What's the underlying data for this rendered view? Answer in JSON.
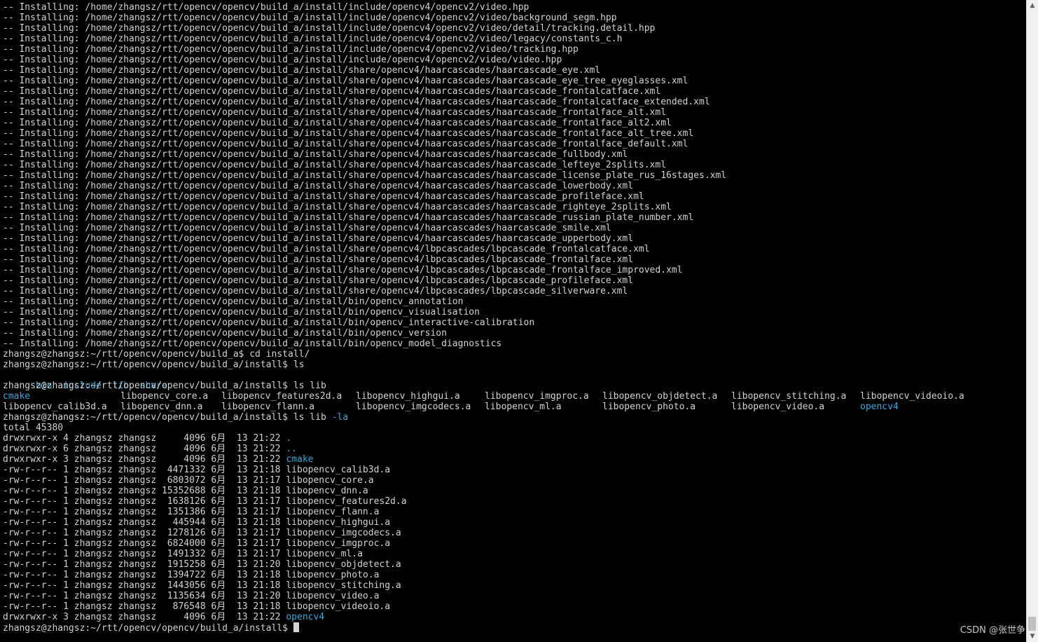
{
  "install_lines": [
    "-- Installing: /home/zhangsz/rtt/opencv/opencv/build_a/install/include/opencv4/opencv2/video.hpp",
    "-- Installing: /home/zhangsz/rtt/opencv/opencv/build_a/install/include/opencv4/opencv2/video/background_segm.hpp",
    "-- Installing: /home/zhangsz/rtt/opencv/opencv/build_a/install/include/opencv4/opencv2/video/detail/tracking.detail.hpp",
    "-- Installing: /home/zhangsz/rtt/opencv/opencv/build_a/install/include/opencv4/opencv2/video/legacy/constants_c.h",
    "-- Installing: /home/zhangsz/rtt/opencv/opencv/build_a/install/include/opencv4/opencv2/video/tracking.hpp",
    "-- Installing: /home/zhangsz/rtt/opencv/opencv/build_a/install/include/opencv4/opencv2/video/video.hpp",
    "-- Installing: /home/zhangsz/rtt/opencv/opencv/build_a/install/share/opencv4/haarcascades/haarcascade_eye.xml",
    "-- Installing: /home/zhangsz/rtt/opencv/opencv/build_a/install/share/opencv4/haarcascades/haarcascade_eye_tree_eyeglasses.xml",
    "-- Installing: /home/zhangsz/rtt/opencv/opencv/build_a/install/share/opencv4/haarcascades/haarcascade_frontalcatface.xml",
    "-- Installing: /home/zhangsz/rtt/opencv/opencv/build_a/install/share/opencv4/haarcascades/haarcascade_frontalcatface_extended.xml",
    "-- Installing: /home/zhangsz/rtt/opencv/opencv/build_a/install/share/opencv4/haarcascades/haarcascade_frontalface_alt.xml",
    "-- Installing: /home/zhangsz/rtt/opencv/opencv/build_a/install/share/opencv4/haarcascades/haarcascade_frontalface_alt2.xml",
    "-- Installing: /home/zhangsz/rtt/opencv/opencv/build_a/install/share/opencv4/haarcascades/haarcascade_frontalface_alt_tree.xml",
    "-- Installing: /home/zhangsz/rtt/opencv/opencv/build_a/install/share/opencv4/haarcascades/haarcascade_frontalface_default.xml",
    "-- Installing: /home/zhangsz/rtt/opencv/opencv/build_a/install/share/opencv4/haarcascades/haarcascade_fullbody.xml",
    "-- Installing: /home/zhangsz/rtt/opencv/opencv/build_a/install/share/opencv4/haarcascades/haarcascade_lefteye_2splits.xml",
    "-- Installing: /home/zhangsz/rtt/opencv/opencv/build_a/install/share/opencv4/haarcascades/haarcascade_license_plate_rus_16stages.xml",
    "-- Installing: /home/zhangsz/rtt/opencv/opencv/build_a/install/share/opencv4/haarcascades/haarcascade_lowerbody.xml",
    "-- Installing: /home/zhangsz/rtt/opencv/opencv/build_a/install/share/opencv4/haarcascades/haarcascade_profileface.xml",
    "-- Installing: /home/zhangsz/rtt/opencv/opencv/build_a/install/share/opencv4/haarcascades/haarcascade_righteye_2splits.xml",
    "-- Installing: /home/zhangsz/rtt/opencv/opencv/build_a/install/share/opencv4/haarcascades/haarcascade_russian_plate_number.xml",
    "-- Installing: /home/zhangsz/rtt/opencv/opencv/build_a/install/share/opencv4/haarcascades/haarcascade_smile.xml",
    "-- Installing: /home/zhangsz/rtt/opencv/opencv/build_a/install/share/opencv4/haarcascades/haarcascade_upperbody.xml",
    "-- Installing: /home/zhangsz/rtt/opencv/opencv/build_a/install/share/opencv4/lbpcascades/lbpcascade_frontalcatface.xml",
    "-- Installing: /home/zhangsz/rtt/opencv/opencv/build_a/install/share/opencv4/lbpcascades/lbpcascade_frontalface.xml",
    "-- Installing: /home/zhangsz/rtt/opencv/opencv/build_a/install/share/opencv4/lbpcascades/lbpcascade_frontalface_improved.xml",
    "-- Installing: /home/zhangsz/rtt/opencv/opencv/build_a/install/share/opencv4/lbpcascades/lbpcascade_profileface.xml",
    "-- Installing: /home/zhangsz/rtt/opencv/opencv/build_a/install/share/opencv4/lbpcascades/lbpcascade_silverware.xml",
    "-- Installing: /home/zhangsz/rtt/opencv/opencv/build_a/install/bin/opencv_annotation",
    "-- Installing: /home/zhangsz/rtt/opencv/opencv/build_a/install/bin/opencv_visualisation",
    "-- Installing: /home/zhangsz/rtt/opencv/opencv/build_a/install/bin/opencv_interactive-calibration",
    "-- Installing: /home/zhangsz/rtt/opencv/opencv/build_a/install/bin/opencv_version",
    "-- Installing: /home/zhangsz/rtt/opencv/opencv/build_a/install/bin/opencv_model_diagnostics"
  ],
  "prompt_build": "zhangsz@zhangsz:~/rtt/opencv/opencv/build_a$ cd install/",
  "prompt_ls": "zhangsz@zhangsz:~/rtt/opencv/opencv/build_a/install$ ls",
  "ls_dirs": [
    "bin",
    "include",
    "lib",
    "share"
  ],
  "prompt_ls_lib": "zhangsz@zhangsz:~/rtt/opencv/opencv/build_a/install$ ls lib",
  "ls_lib_row1": [
    {
      "name": "cmake",
      "dir": true
    },
    {
      "name": "libopencv_core.a",
      "dir": false
    },
    {
      "name": "libopencv_features2d.a",
      "dir": false
    },
    {
      "name": "libopencv_highgui.a",
      "dir": false
    },
    {
      "name": "libopencv_imgproc.a",
      "dir": false
    },
    {
      "name": "libopencv_objdetect.a",
      "dir": false
    },
    {
      "name": "libopencv_stitching.a",
      "dir": false
    },
    {
      "name": "libopencv_videoio.a",
      "dir": false
    }
  ],
  "ls_lib_row2": [
    {
      "name": "libopencv_calib3d.a",
      "dir": false
    },
    {
      "name": "libopencv_dnn.a",
      "dir": false
    },
    {
      "name": "libopencv_flann.a",
      "dir": false
    },
    {
      "name": "libopencv_imgcodecs.a",
      "dir": false
    },
    {
      "name": "libopencv_ml.a",
      "dir": false
    },
    {
      "name": "libopencv_photo.a",
      "dir": false
    },
    {
      "name": "libopencv_video.a",
      "dir": false
    },
    {
      "name": "opencv4",
      "dir": true
    }
  ],
  "prompt_ls_la_prefix": "zhangsz@zhangsz:~/rtt/opencv/opencv/build_a/install$ ls lib ",
  "prompt_ls_la_flag": "-la",
  "total_line": "total 45380",
  "ls_la_rows": [
    {
      "meta": "drwxrwxr-x 4 zhangsz zhangsz     4096 6月  13 21:22 ",
      "name": ".",
      "dir": true
    },
    {
      "meta": "drwxrwxr-x 6 zhangsz zhangsz     4096 6月  13 21:22 ",
      "name": "..",
      "dir": true
    },
    {
      "meta": "drwxrwxr-x 3 zhangsz zhangsz     4096 6月  13 21:22 ",
      "name": "cmake",
      "dir": true
    },
    {
      "meta": "-rw-r--r-- 1 zhangsz zhangsz  4471332 6月  13 21:18 ",
      "name": "libopencv_calib3d.a",
      "dir": false
    },
    {
      "meta": "-rw-r--r-- 1 zhangsz zhangsz  6803072 6月  13 21:17 ",
      "name": "libopencv_core.a",
      "dir": false
    },
    {
      "meta": "-rw-r--r-- 1 zhangsz zhangsz 15352688 6月  13 21:18 ",
      "name": "libopencv_dnn.a",
      "dir": false
    },
    {
      "meta": "-rw-r--r-- 1 zhangsz zhangsz  1638126 6月  13 21:17 ",
      "name": "libopencv_features2d.a",
      "dir": false
    },
    {
      "meta": "-rw-r--r-- 1 zhangsz zhangsz  1351386 6月  13 21:17 ",
      "name": "libopencv_flann.a",
      "dir": false
    },
    {
      "meta": "-rw-r--r-- 1 zhangsz zhangsz   445944 6月  13 21:18 ",
      "name": "libopencv_highgui.a",
      "dir": false
    },
    {
      "meta": "-rw-r--r-- 1 zhangsz zhangsz  1278126 6月  13 21:17 ",
      "name": "libopencv_imgcodecs.a",
      "dir": false
    },
    {
      "meta": "-rw-r--r-- 1 zhangsz zhangsz  6824000 6月  13 21:17 ",
      "name": "libopencv_imgproc.a",
      "dir": false
    },
    {
      "meta": "-rw-r--r-- 1 zhangsz zhangsz  1491332 6月  13 21:17 ",
      "name": "libopencv_ml.a",
      "dir": false
    },
    {
      "meta": "-rw-r--r-- 1 zhangsz zhangsz  1915258 6月  13 21:20 ",
      "name": "libopencv_objdetect.a",
      "dir": false
    },
    {
      "meta": "-rw-r--r-- 1 zhangsz zhangsz  1394722 6月  13 21:18 ",
      "name": "libopencv_photo.a",
      "dir": false
    },
    {
      "meta": "-rw-r--r-- 1 zhangsz zhangsz  1443056 6月  13 21:18 ",
      "name": "libopencv_stitching.a",
      "dir": false
    },
    {
      "meta": "-rw-r--r-- 1 zhangsz zhangsz  1135634 6月  13 21:20 ",
      "name": "libopencv_video.a",
      "dir": false
    },
    {
      "meta": "-rw-r--r-- 1 zhangsz zhangsz   876548 6月  13 21:18 ",
      "name": "libopencv_videoio.a",
      "dir": false
    },
    {
      "meta": "drwxrwxr-x 3 zhangsz zhangsz     4096 6月  13 21:22 ",
      "name": "opencv4",
      "dir": true
    }
  ],
  "final_prompt": "zhangsz@zhangsz:~/rtt/opencv/opencv/build_a/install$ ",
  "watermark": "CSDN @张世争",
  "colors": {
    "background": "#000000",
    "text": "#d2d2d2",
    "directory": "#3aa6d8"
  },
  "scrollbar": {
    "up_icon": "scroll-up-arrow-icon",
    "down_icon": "scroll-down-arrow-icon"
  }
}
